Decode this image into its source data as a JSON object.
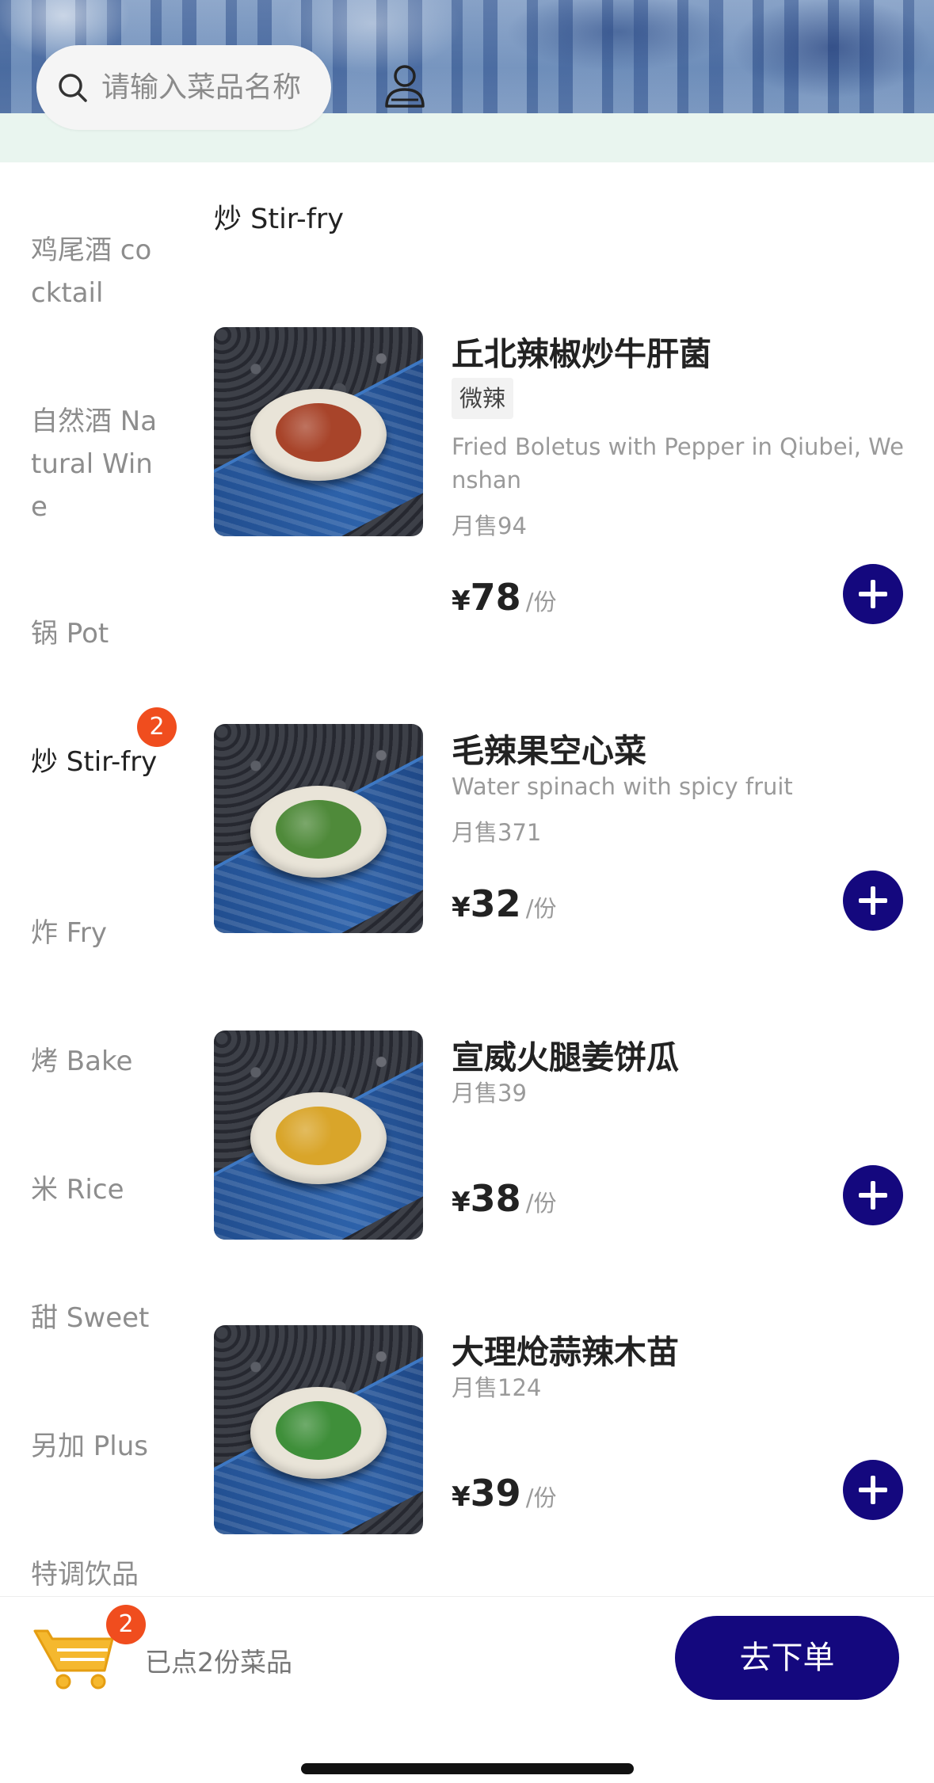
{
  "header": {
    "search_placeholder": "请输入菜品名称"
  },
  "sidebar": {
    "categories": [
      {
        "label": "鸡尾酒 cocktail",
        "active": false
      },
      {
        "label": "自然酒 Natural Wine",
        "active": false
      },
      {
        "label": "锅 Pot",
        "active": false
      },
      {
        "label": "炒 Stir-fry",
        "active": true,
        "badge": "2"
      },
      {
        "label": "炸 Fry",
        "active": false
      },
      {
        "label": "烤 Bake",
        "active": false
      },
      {
        "label": "米 Rice",
        "active": false
      },
      {
        "label": "甜 Sweet",
        "active": false
      },
      {
        "label": "另加 Plus",
        "active": false
      },
      {
        "label": "特调饮品",
        "active": false
      }
    ]
  },
  "section": {
    "title": "炒 Stir-fry"
  },
  "dishes": [
    {
      "name": "丘北辣椒炒牛肝菌",
      "tag": "微辣",
      "description": "Fried Boletus with Pepper in Qiubei, Wenshan",
      "sales": "月售94",
      "currency": "¥",
      "price": "78",
      "unit": "/份",
      "food_color": "#a8442a"
    },
    {
      "name": "毛辣果空心菜",
      "description": "Water spinach with spicy fruit",
      "sales": "月售371",
      "currency": "¥",
      "price": "32",
      "unit": "/份",
      "food_color": "#4f8a3a"
    },
    {
      "name": "宣威火腿姜饼瓜",
      "sales": "月售39",
      "currency": "¥",
      "price": "38",
      "unit": "/份",
      "food_color": "#d9a52a"
    },
    {
      "name": "大理炝蒜辣木苗",
      "sales": "月售124",
      "currency": "¥",
      "price": "39",
      "unit": "/份",
      "food_color": "#3f8f3a"
    }
  ],
  "cart": {
    "badge": "2",
    "summary": "已点2份菜品",
    "order_label": "去下单"
  },
  "colors": {
    "accent": "#14087e",
    "badge": "#f04d1e",
    "cart_yellow": "#f5b82e"
  }
}
